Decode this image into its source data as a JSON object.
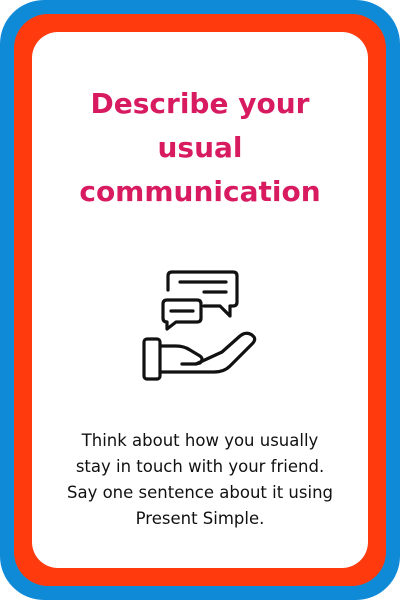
{
  "card": {
    "title_lines": [
      "Describe your",
      "usual",
      "communication"
    ],
    "instruction_lines": [
      "Think about how you usually",
      "stay in touch with your friend.",
      "Say one sentence about it using",
      "Present Simple."
    ],
    "icon": "hand-holding-chat-bubbles-icon"
  },
  "colors": {
    "outer_border": "#0e8ad6",
    "inner_border": "#ff3a0d",
    "title": "#d81b60",
    "text": "#111111"
  }
}
